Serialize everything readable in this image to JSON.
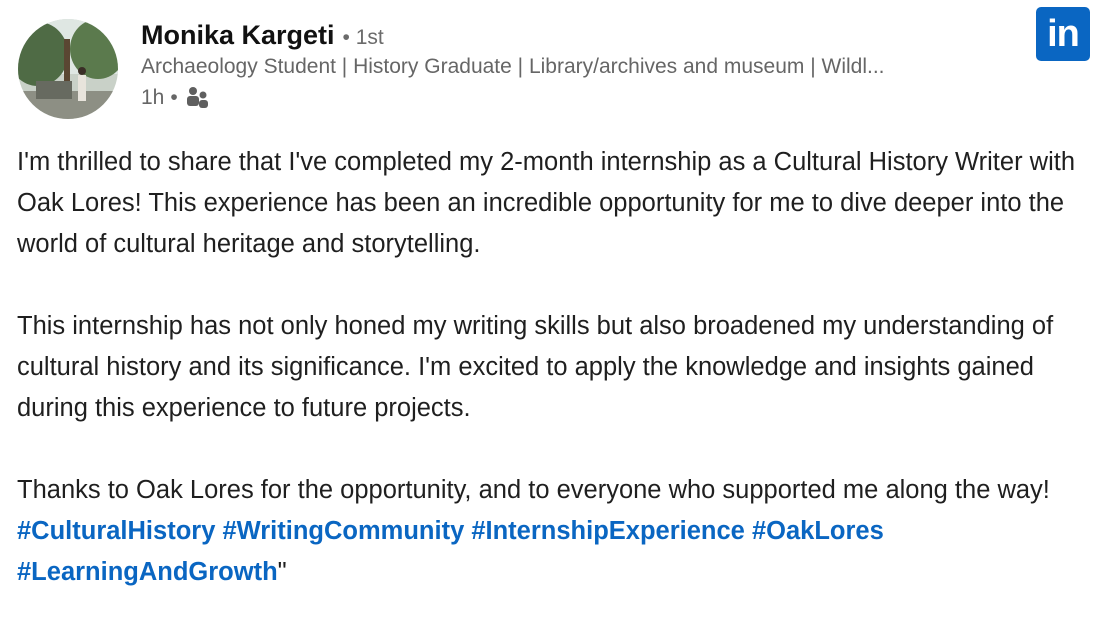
{
  "post": {
    "author": {
      "name": "Monika Kargeti",
      "degree": "• 1st",
      "headline": "Archaeology Student | History Graduate | Library/archives and museum | Wildl...",
      "time": "1h",
      "separator": "•",
      "audience_icon": "connections-icon",
      "avatar_icon": "profile-photo"
    },
    "logo": {
      "text": "in",
      "icon": "linkedin-logo",
      "color": "#0a66c2"
    },
    "paragraphs": [
      "I'm thrilled to share that I've completed my 2-month internship as a Cultural History Writer with Oak Lores! This experience has been an incredible opportunity for me to dive deeper into the world of cultural heritage and storytelling.",
      "This internship has not only honed my writing skills but also broadened my understanding of cultural history and its significance. I'm excited to apply the knowledge and insights gained during this experience to future projects.",
      "Thanks to Oak Lores for the opportunity, and to everyone who supported me along the way!"
    ],
    "hashtags": [
      "#CulturalHistory",
      "#WritingCommunity",
      "#InternshipExperience",
      "#OakLores",
      "#LearningAndGrowth"
    ],
    "closing_quote": "\"",
    "hashtag_color": "#0a66c2"
  }
}
